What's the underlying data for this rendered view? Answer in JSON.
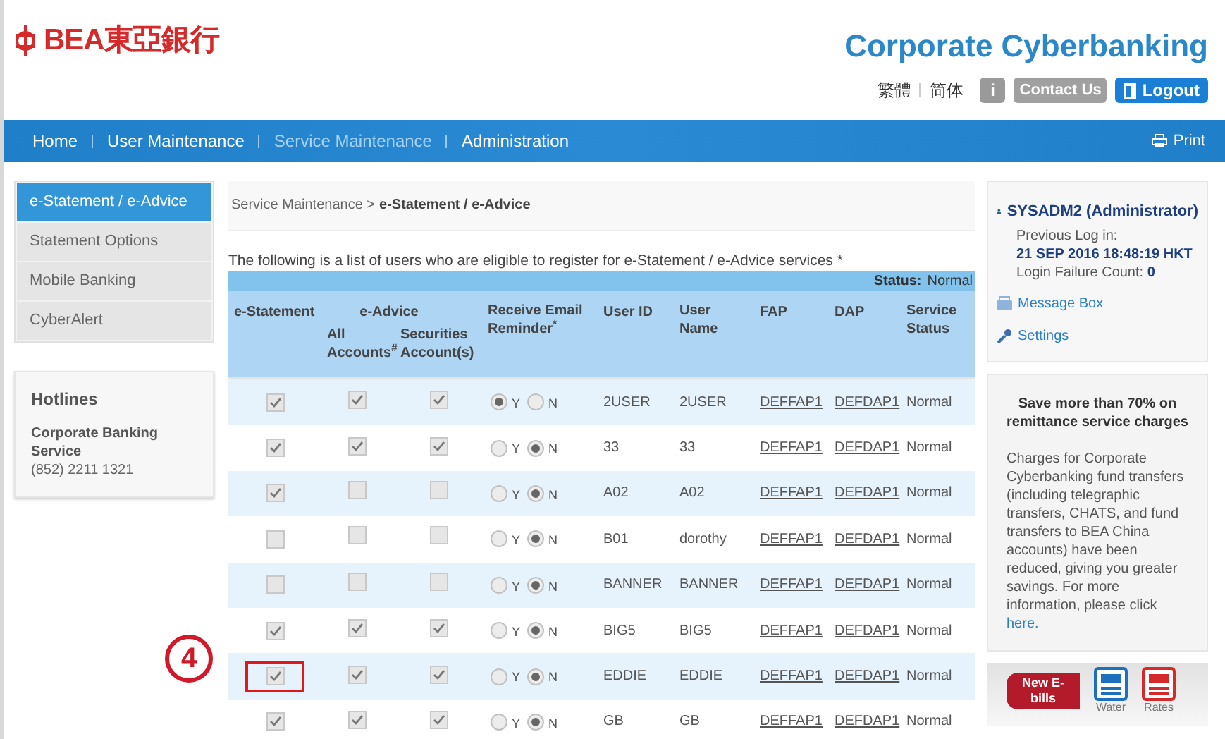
{
  "header": {
    "logo_text": "BEA東亞銀行",
    "title": "Corporate Cyberbanking",
    "languages": [
      "繁體",
      "简体"
    ],
    "info_button": "i",
    "contact_button": "Contact Us",
    "logout_button": "Logout"
  },
  "nav": {
    "items": [
      {
        "label": "Home",
        "selected": false
      },
      {
        "label": "User Maintenance",
        "selected": false
      },
      {
        "label": "Service Maintenance",
        "selected": true
      },
      {
        "label": "Administration",
        "selected": false
      }
    ],
    "print": "Print"
  },
  "sidebar": {
    "items": [
      {
        "label": "e-Statement / e-Advice",
        "selected": true
      },
      {
        "label": "Statement Options",
        "selected": false
      },
      {
        "label": "Mobile Banking",
        "selected": false
      },
      {
        "label": "CyberAlert",
        "selected": false
      }
    ],
    "hotlines": {
      "title": "Hotlines",
      "service": "Corporate Banking Service",
      "phone": "(852) 2211 1321"
    }
  },
  "breadcrumb": {
    "parent": "Service Maintenance >",
    "current": "e-Statement / e-Advice"
  },
  "intro": "The following is a list of users who are eligible to register for e-Statement / e-Advice services *",
  "status": {
    "label": "Status:",
    "value": "Normal"
  },
  "table": {
    "columns": {
      "e_statement": "e-Statement",
      "e_advice": "e-Advice",
      "all_accounts": "All Accounts$^{#}$",
      "securities": "Securities Account(s)",
      "reminder": "Receive Email Reminder$^{*}$",
      "user_id": "User ID",
      "user_name": "User Name",
      "fap": "FAP",
      "dap": "DAP",
      "service_status": "Service Status"
    },
    "rows": [
      {
        "e_statement": true,
        "all_accounts": true,
        "securities": true,
        "reminder": [
          {
            "label": "Y",
            "selected": true
          },
          {
            "label": "N",
            "selected": false
          }
        ],
        "user_id": "2USER",
        "user_name": "2USER",
        "fap": "DEFFAP1",
        "dap": "DEFDAP1",
        "service_status": "Normal",
        "highlighted": false
      },
      {
        "e_statement": true,
        "all_accounts": true,
        "securities": true,
        "reminder": [
          {
            "label": "Y",
            "selected": false
          },
          {
            "label": "N",
            "selected": true
          }
        ],
        "user_id": "33",
        "user_name": "33",
        "fap": "DEFFAP1",
        "dap": "DEFDAP1",
        "service_status": "Normal",
        "highlighted": false
      },
      {
        "e_statement": true,
        "all_accounts": false,
        "securities": false,
        "reminder": [
          {
            "label": "Y",
            "selected": false
          },
          {
            "label": "N",
            "selected": true
          }
        ],
        "user_id": "A02",
        "user_name": "A02",
        "fap": "DEFFAP1",
        "dap": "DEFDAP1",
        "service_status": "Normal",
        "highlighted": false
      },
      {
        "e_statement": false,
        "all_accounts": false,
        "securities": false,
        "reminder": [
          {
            "label": "Y",
            "selected": false
          },
          {
            "label": "N",
            "selected": true
          }
        ],
        "user_id": "B01",
        "user_name": "dorothy",
        "fap": "DEFFAP1",
        "dap": "DEFDAP1",
        "service_status": "Normal",
        "highlighted": false
      },
      {
        "e_statement": false,
        "all_accounts": false,
        "securities": false,
        "reminder": [
          {
            "label": "Y",
            "selected": false
          },
          {
            "label": "N",
            "selected": true
          }
        ],
        "user_id": "BANNER",
        "user_name": "BANNER",
        "fap": "DEFFAP1",
        "dap": "DEFDAP1",
        "service_status": "Normal",
        "highlighted": false
      },
      {
        "e_statement": true,
        "all_accounts": true,
        "securities": true,
        "reminder": [
          {
            "label": "Y",
            "selected": false
          },
          {
            "label": "N",
            "selected": true
          }
        ],
        "user_id": "BIG5",
        "user_name": "BIG5",
        "fap": "DEFFAP1",
        "dap": "DEFDAP1",
        "service_status": "Normal",
        "highlighted": false
      },
      {
        "e_statement": true,
        "all_accounts": true,
        "securities": true,
        "reminder": [
          {
            "label": "Y",
            "selected": false
          },
          {
            "label": "N",
            "selected": true
          }
        ],
        "user_id": "EDDIE",
        "user_name": "EDDIE",
        "fap": "DEFFAP1",
        "dap": "DEFDAP1",
        "service_status": "Normal",
        "highlighted": true
      },
      {
        "e_statement": true,
        "all_accounts": true,
        "securities": true,
        "reminder": [
          {
            "label": "Y",
            "selected": false
          },
          {
            "label": "N",
            "selected": true
          }
        ],
        "user_id": "GB",
        "user_name": "GB",
        "fap": "DEFFAP1",
        "dap": "DEFDAP1",
        "service_status": "Normal",
        "highlighted": false
      }
    ]
  },
  "step_callout": "4",
  "user_panel": {
    "name": "SYSADM2 (Administrator)",
    "previous_label": "Previous Log in:",
    "previous_time": "21 SEP 2016 18:48:19 HKT",
    "failure": "Login Failure Count: **0**",
    "links": [
      "Message Box",
      "Settings"
    ]
  },
  "promo": {
    "title": "Save more than 70% on remittance service charges",
    "body": "Charges for Corporate Cyberbanking fund transfers (including telegraphic transfers, CHATS, and fund transfers to BEA China accounts) have been reduced, giving you greater savings. For more information, please click ",
    "link": "here."
  },
  "ebills": {
    "tag": "New E-bills",
    "items": [
      "Water",
      "Rates"
    ]
  }
}
